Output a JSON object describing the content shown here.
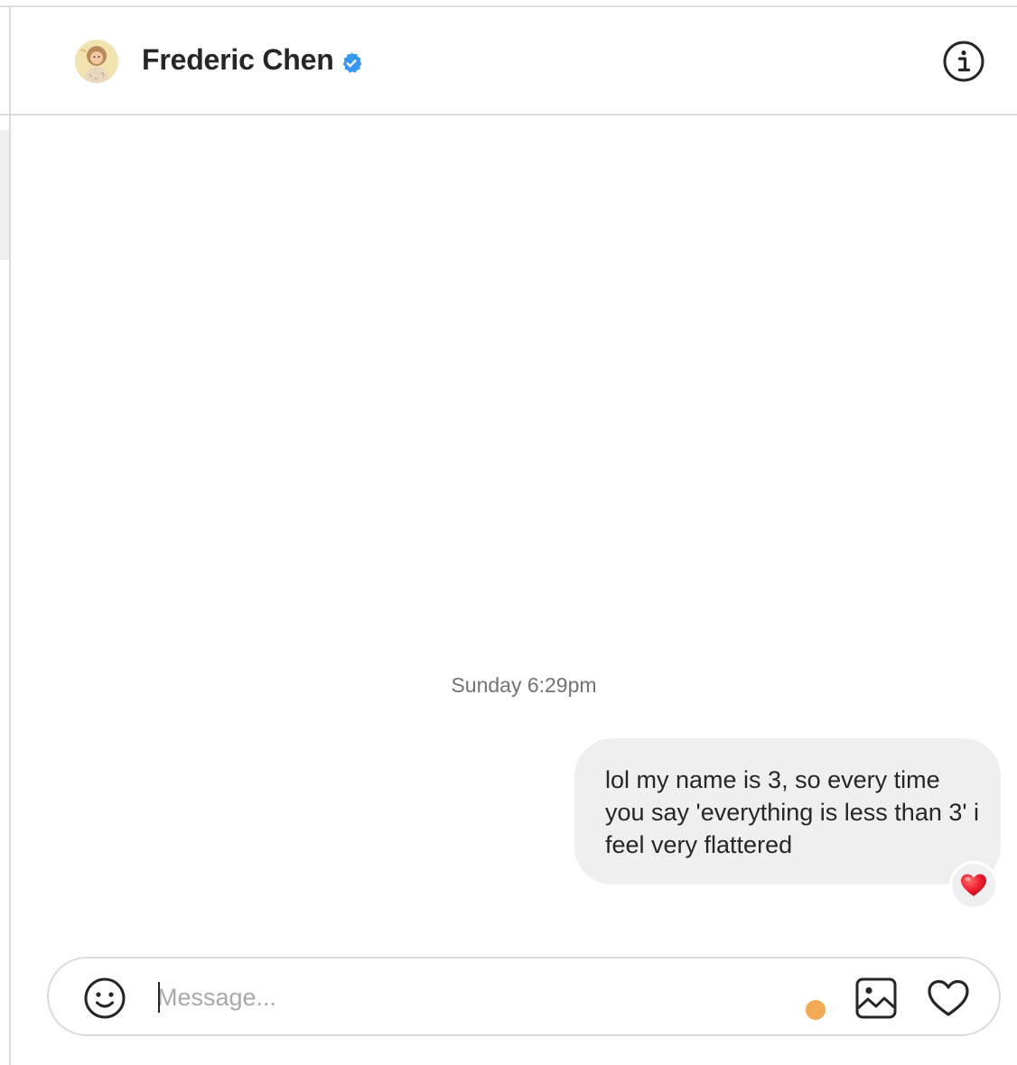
{
  "header": {
    "contact_name": "Frederic Chen",
    "verified": true,
    "avatar_icon": "profile-photo",
    "info_icon": "info-icon"
  },
  "thread": {
    "timestamp": "Sunday 6:29pm",
    "messages": [
      {
        "sender": "me",
        "text": "lol my name is 3, so every time you say 'everything is less than 3' i feel very flattered",
        "reaction": "❤️"
      }
    ]
  },
  "composer": {
    "placeholder": "Message...",
    "value": "",
    "emoji_icon": "smiley-icon",
    "image_icon": "image-icon",
    "like_icon": "heart-icon"
  },
  "colors": {
    "verified_blue": "#3897f0",
    "bubble_bg": "#efefef",
    "border": "#dbdbdb",
    "timestamp_gray": "#737373",
    "status_dot": "#f2a954",
    "reaction_red": "#ed1c2e"
  }
}
